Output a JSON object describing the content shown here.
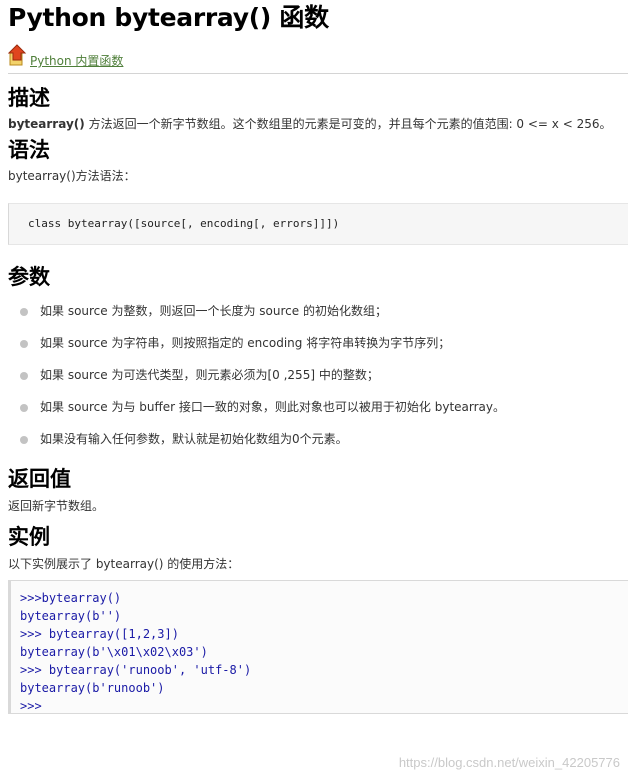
{
  "title": "Python bytearray() 函数",
  "back_link": {
    "label": "Python 内置函数",
    "icon": "up-arrow-icon"
  },
  "desc": {
    "heading": "描述",
    "func_name": "bytearray()",
    "text": " 方法返回一个新字节数组。这个数组里的元素是可变的，并且每个元素的值范围: 0 <= x < 256。"
  },
  "syntax": {
    "heading": "语法",
    "intro": "bytearray()方法语法：",
    "code": "class bytearray([source[, encoding[, errors]]])"
  },
  "params": {
    "heading": "参数",
    "items": [
      "如果 source 为整数，则返回一个长度为 source 的初始化数组；",
      "如果 source 为字符串，则按照指定的 encoding 将字符串转换为字节序列；",
      "如果 source 为可迭代类型，则元素必须为[0 ,255] 中的整数；",
      "如果 source 为与 buffer 接口一致的对象，则此对象也可以被用于初始化 bytearray。",
      "如果没有输入任何参数，默认就是初始化数组为0个元素。"
    ]
  },
  "returns": {
    "heading": "返回值",
    "text": "返回新字节数组。"
  },
  "example": {
    "heading": "实例",
    "intro": "以下实例展示了 bytearray() 的使用方法：",
    "lines": [
      ">>>bytearray()",
      "bytearray(b'')",
      ">>> bytearray([1,2,3])",
      "bytearray(b'\\x01\\x02\\x03')",
      ">>> bytearray('runoob', 'utf-8')",
      "bytearray(b'runoob')",
      ">>>"
    ]
  },
  "watermark": "https://blog.csdn.net/weixin_42205776"
}
